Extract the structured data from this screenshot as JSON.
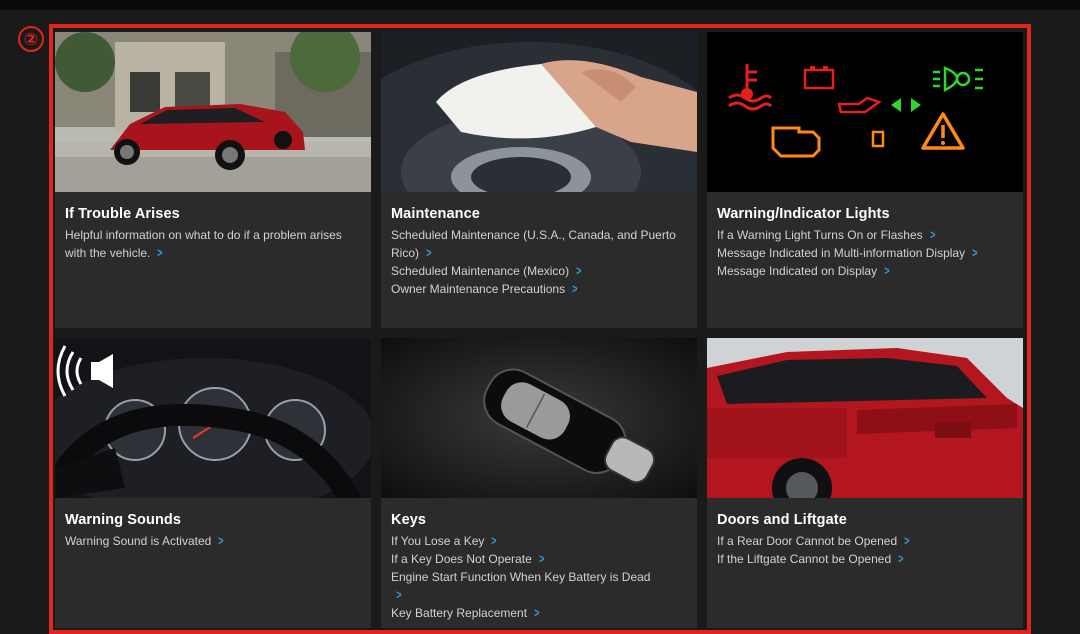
{
  "marker": "②",
  "colors": {
    "accent_frame": "#e0261b",
    "link_chevron": "#2a9fe0",
    "card_bg": "#2b2b2b",
    "page_bg": "#1a1a1a"
  },
  "cards": [
    {
      "title": "If Trouble Arises",
      "image": "red-suv-street-photo",
      "links": [
        {
          "label": "Helpful information on what to do if a problem arises with the vehicle."
        }
      ]
    },
    {
      "title": "Maintenance",
      "image": "hand-cleaning-steering-wheel-photo",
      "links": [
        {
          "label": "Scheduled Maintenance (U.S.A., Canada, and Puerto Rico)"
        },
        {
          "label": "Scheduled Maintenance (Mexico)"
        },
        {
          "label": "Owner Maintenance Precautions"
        }
      ]
    },
    {
      "title": "Warning/Indicator Lights",
      "image": "dashboard-warning-light-icons",
      "links": [
        {
          "label": "If a Warning Light Turns On or Flashes"
        },
        {
          "label": "Message Indicated in Multi-information Display"
        },
        {
          "label": "Message Indicated on Display"
        }
      ]
    },
    {
      "title": "Warning Sounds",
      "image": "instrument-cluster-with-speaker-icon",
      "links": [
        {
          "label": "Warning Sound is Activated"
        }
      ]
    },
    {
      "title": "Keys",
      "image": "smart-key-fob-photo",
      "links": [
        {
          "label": "If You Lose a Key"
        },
        {
          "label": "If a Key Does Not Operate"
        },
        {
          "label": "Engine Start Function When Key Battery is Dead"
        },
        {
          "label": "Key Battery Replacement"
        }
      ]
    },
    {
      "title": "Doors and Liftgate",
      "image": "red-suv-rear-view-photo",
      "links": [
        {
          "label": "If a Rear Door Cannot be Opened"
        },
        {
          "label": "If the Liftgate Cannot be Opened"
        }
      ]
    }
  ]
}
